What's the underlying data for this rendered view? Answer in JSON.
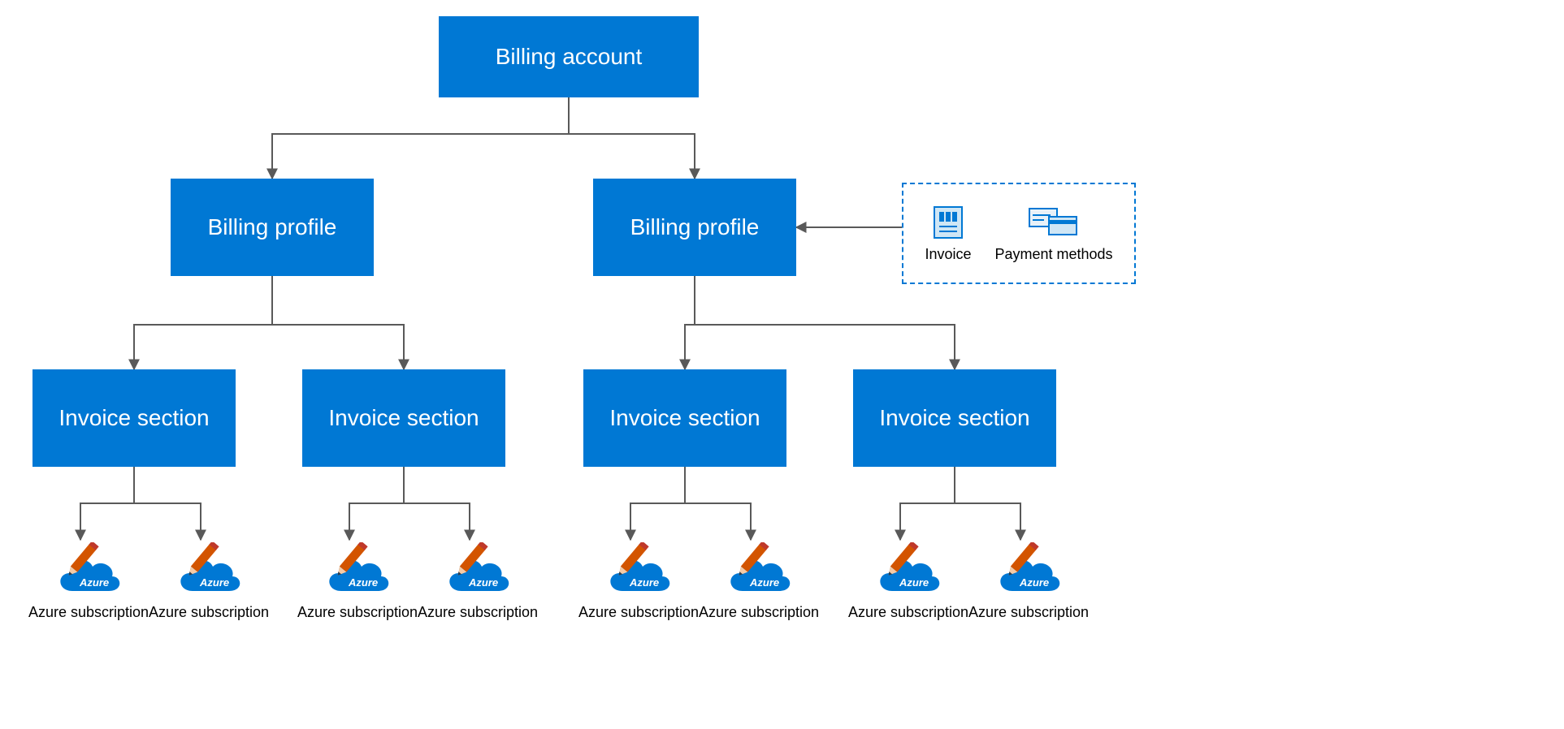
{
  "root": {
    "label": "Billing account"
  },
  "profiles": [
    {
      "label": "Billing profile"
    },
    {
      "label": "Billing profile"
    }
  ],
  "sections": [
    {
      "label": "Invoice section"
    },
    {
      "label": "Invoice section"
    },
    {
      "label": "Invoice section"
    },
    {
      "label": "Invoice section"
    }
  ],
  "subscription_label": "Azure subscription",
  "sidebox": {
    "invoice_label": "Invoice",
    "payment_label": "Payment methods"
  },
  "colors": {
    "primary": "#0078d4",
    "arrow": "#595959",
    "pencil_body": "#d35400",
    "pencil_tip": "#f39c12"
  }
}
